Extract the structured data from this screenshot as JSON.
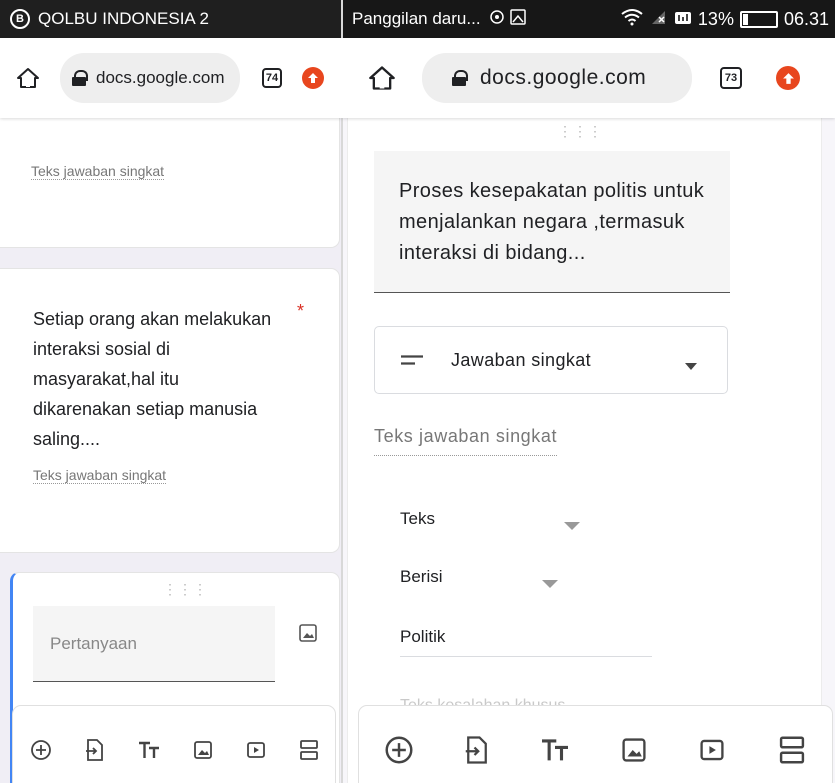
{
  "left": {
    "status": {
      "app_name": "QOLBU INDONESIA 2",
      "b_glyph": "B"
    },
    "urlbar": {
      "domain": "docs.google.com",
      "tab_count": "74"
    },
    "card1": {
      "answer_placeholder": "Teks jawaban singkat"
    },
    "card2": {
      "question": "Setiap orang akan melakukan interaksi sosial di masyarakat,hal itu dikarenakan setiap manusia saling....",
      "required_mark": "*",
      "answer_placeholder": "Teks jawaban singkat"
    },
    "card3": {
      "drag_handle": "⋮⋮⋮",
      "question_placeholder": "Pertanyaan"
    },
    "toolbar": {
      "icons": [
        "add-question-icon",
        "import-question-icon",
        "title-text-icon",
        "image-icon",
        "video-icon",
        "section-icon"
      ]
    }
  },
  "right": {
    "status": {
      "notification": "Panggilan daru...",
      "battery": "13%",
      "time": "06.31"
    },
    "urlbar": {
      "domain": "docs.google.com",
      "tab_count": "73"
    },
    "card": {
      "drag_handle": "⋮⋮⋮",
      "question": "Proses kesepakatan politis untuk menjalankan negara ,termasuk interaksi di bidang...",
      "type_label": "Jawaban singkat",
      "answer_placeholder": "Teks jawaban singkat",
      "validation_type": "Teks",
      "validation_rule": "Berisi",
      "validation_value": "Politik",
      "error_placeholder": "Teks kesalahan khusus"
    },
    "toolbar": {
      "icons": [
        "add-question-icon",
        "import-question-icon",
        "title-text-icon",
        "image-icon",
        "video-icon",
        "section-icon"
      ]
    }
  },
  "colors": {
    "accent_red": "#e8461e",
    "required": "#d93025",
    "status_bg": "#1f1f1f",
    "gap": "#f0eef5"
  }
}
